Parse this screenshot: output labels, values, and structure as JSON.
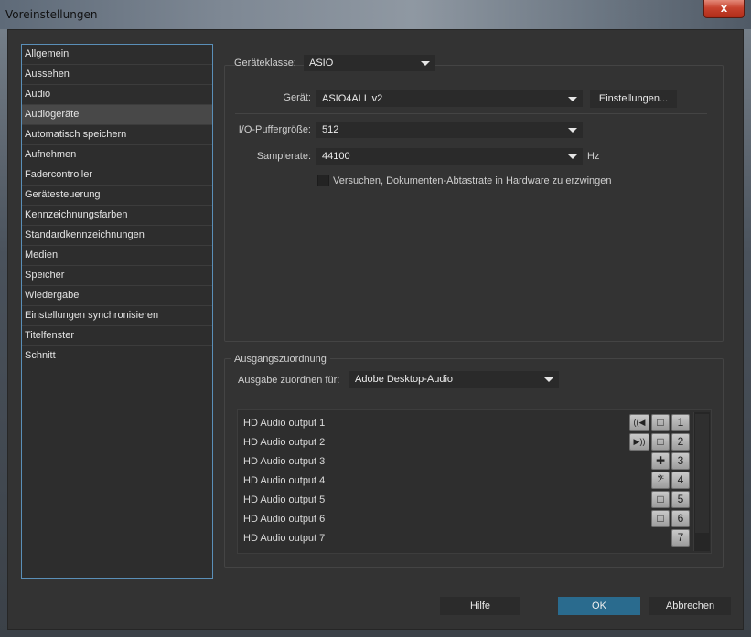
{
  "window": {
    "title": "Voreinstellungen",
    "close_label": "x"
  },
  "sidebar": {
    "items": [
      {
        "label": "Allgemein"
      },
      {
        "label": "Aussehen"
      },
      {
        "label": "Audio"
      },
      {
        "label": "Audiogeräte",
        "selected": true
      },
      {
        "label": "Automatisch speichern"
      },
      {
        "label": "Aufnehmen"
      },
      {
        "label": "Fadercontroller"
      },
      {
        "label": "Gerätesteuerung"
      },
      {
        "label": "Kennzeichnungsfarben"
      },
      {
        "label": "Standardkennzeichnungen"
      },
      {
        "label": "Medien"
      },
      {
        "label": "Speicher"
      },
      {
        "label": "Wiedergabe"
      },
      {
        "label": "Einstellungen synchronisieren"
      },
      {
        "label": "Titelfenster"
      },
      {
        "label": "Schnitt"
      }
    ]
  },
  "device": {
    "class_label": "Geräteklasse:",
    "class_value": "ASIO",
    "device_label": "Gerät:",
    "device_value": "ASIO4ALL v2",
    "settings_button": "Einstellungen...",
    "buffer_label": "I/O-Puffergröße:",
    "buffer_value": "512",
    "samplerate_label": "Samplerate:",
    "samplerate_value": "44100",
    "samplerate_unit": "Hz",
    "force_checkbox_label": "Versuchen, Dokumenten-Abtastrate in Hardware zu erzwingen",
    "force_checkbox_checked": false
  },
  "output_mapping": {
    "group_title": "Ausgangszuordnung",
    "map_label": "Ausgabe zuordnen für:",
    "map_value": "Adobe Desktop-Audio",
    "outputs": [
      {
        "label": "HD Audio output 1",
        "number": "1",
        "icons": [
          "speaker-left-icon",
          "mono-icon"
        ]
      },
      {
        "label": "HD Audio output 2",
        "number": "2",
        "icons": [
          "speaker-right-icon",
          "mono-icon"
        ]
      },
      {
        "label": "HD Audio output 3",
        "number": "3",
        "icons": [
          "center-icon"
        ]
      },
      {
        "label": "HD Audio output 4",
        "number": "4",
        "icons": [
          "lfe-bass-clef-icon"
        ]
      },
      {
        "label": "HD Audio output 5",
        "number": "5",
        "icons": [
          "mono-icon"
        ]
      },
      {
        "label": "HD Audio output 6",
        "number": "6",
        "icons": [
          "mono-icon"
        ]
      },
      {
        "label": "HD Audio output 7",
        "number": "7",
        "icons": []
      }
    ]
  },
  "footer": {
    "help_button": "Hilfe",
    "ok_button": "OK",
    "cancel_button": "Abbrechen"
  }
}
